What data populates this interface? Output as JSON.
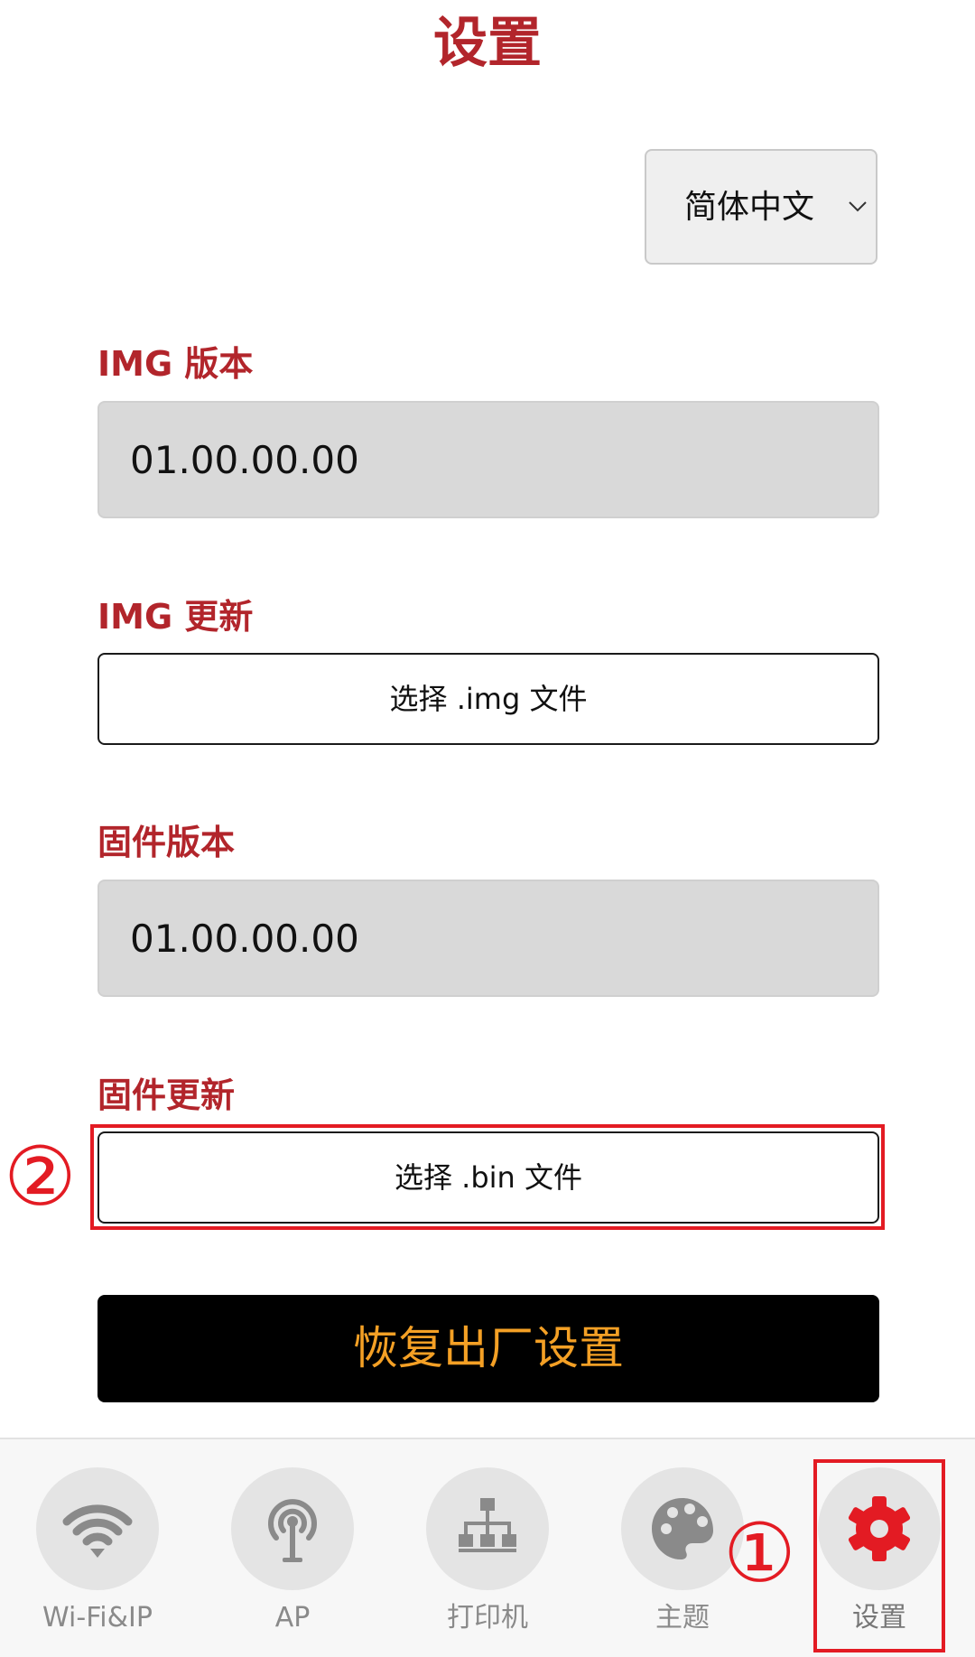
{
  "header": {
    "title": "设置"
  },
  "language": {
    "selected": "简体中文"
  },
  "img_version": {
    "label": "IMG 版本",
    "value": "01.00.00.00"
  },
  "img_update": {
    "label": "IMG 更新",
    "button": "选择 .img 文件"
  },
  "fw_version": {
    "label": "固件版本",
    "value": "01.00.00.00"
  },
  "fw_update": {
    "label": "固件更新",
    "button": "选择 .bin 文件"
  },
  "reset": {
    "label": "恢复出厂设置"
  },
  "annotations": {
    "step1": "①",
    "step2": "②",
    "color": "#e31b23"
  },
  "colors": {
    "accent": "#b2252b",
    "reset_text": "#f4a025",
    "active_icon": "#e31b23",
    "inactive_icon": "#8a8a8a"
  },
  "nav": [
    {
      "label": "Wi-Fi&IP",
      "icon": "wifi-icon"
    },
    {
      "label": "AP",
      "icon": "antenna-icon"
    },
    {
      "label": "打印机",
      "icon": "network-tree-icon"
    },
    {
      "label": "主题",
      "icon": "palette-icon"
    },
    {
      "label": "设置",
      "icon": "gear-icon",
      "active": true
    }
  ]
}
